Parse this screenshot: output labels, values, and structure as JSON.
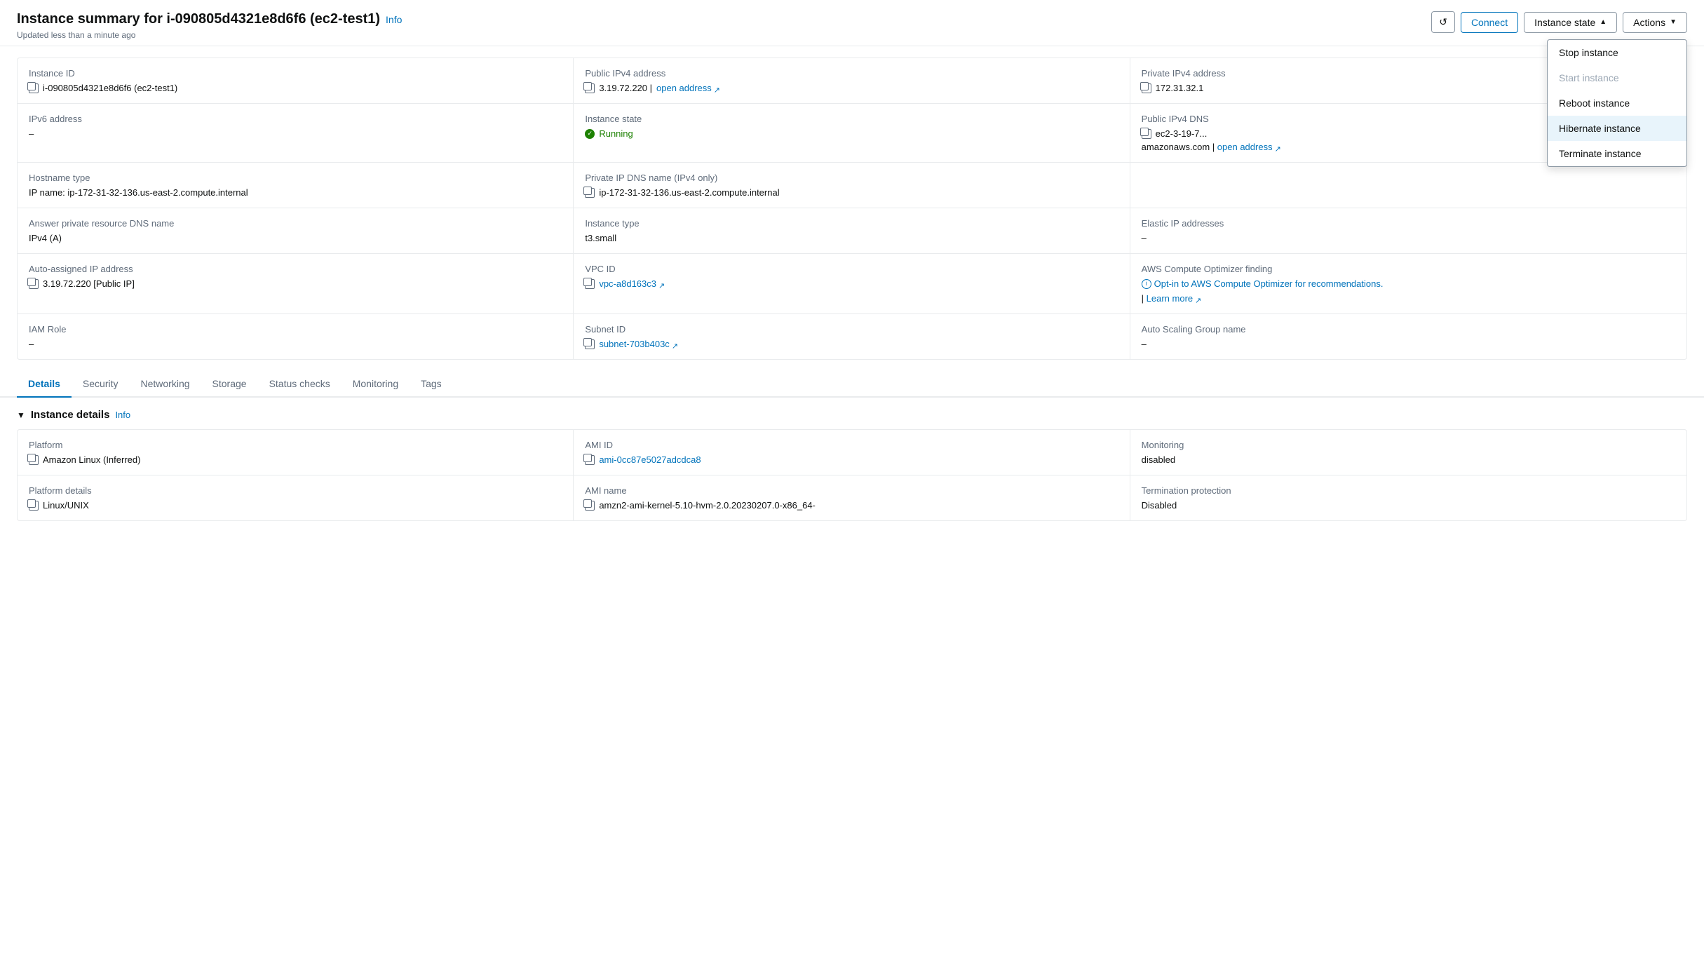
{
  "header": {
    "title": "Instance summary for i-090805d4321e8d6f6 (ec2-test1)",
    "info_label": "Info",
    "subtitle": "Updated less than a minute ago",
    "buttons": {
      "refresh_title": "Refresh",
      "connect": "Connect",
      "instance_state": "Instance state",
      "actions": "Actions"
    }
  },
  "dropdown_menu": {
    "items": [
      {
        "label": "Stop instance",
        "disabled": false,
        "highlighted": false
      },
      {
        "label": "Start instance",
        "disabled": true,
        "highlighted": false
      },
      {
        "label": "Reboot instance",
        "disabled": false,
        "highlighted": false
      },
      {
        "label": "Hibernate instance",
        "disabled": false,
        "highlighted": true
      },
      {
        "label": "Terminate instance",
        "disabled": false,
        "highlighted": false
      }
    ]
  },
  "instance_fields": {
    "row1": [
      {
        "label": "Instance ID",
        "value": "i-090805d4321e8d6f6 (ec2-test1)",
        "has_copy": true,
        "is_link": false
      },
      {
        "label": "Public IPv4 address",
        "value": "3.19.72.220",
        "has_copy": true,
        "has_open_link": true,
        "open_link_text": "open address",
        "is_link": false
      },
      {
        "label": "Private IPv4 address",
        "value": "172.31.32.1",
        "has_copy": true,
        "is_link": false,
        "truncated": true
      }
    ],
    "row2": [
      {
        "label": "IPv6 address",
        "value": "–",
        "has_copy": false
      },
      {
        "label": "Instance state",
        "value": "Running",
        "is_status": true
      },
      {
        "label": "Public IPv4 DNS",
        "value": "ec2-3-19-7...",
        "extra": "amazonaws.com |",
        "has_copy": true,
        "has_open_link": true,
        "open_link_text": "open address",
        "truncated": true
      }
    ],
    "row3": [
      {
        "label": "Hostname type",
        "value": "IP name: ip-172-31-32-136.us-east-2.compute.internal",
        "has_copy": false
      },
      {
        "label": "Private IP DNS name (IPv4 only)",
        "value": "ip-172-31-32-136.us-east-2.compute.internal",
        "has_copy": true
      },
      {
        "label": "",
        "value": "",
        "empty": true
      }
    ],
    "row4": [
      {
        "label": "Answer private resource DNS name",
        "value": "IPv4 (A)",
        "has_copy": false
      },
      {
        "label": "Instance type",
        "value": "t3.small",
        "has_copy": false
      },
      {
        "label": "Elastic IP addresses",
        "value": "–",
        "has_copy": false
      }
    ],
    "row5": [
      {
        "label": "Auto-assigned IP address",
        "value": "3.19.72.220 [Public IP]",
        "has_copy": true
      },
      {
        "label": "VPC ID",
        "value": "vpc-a8d163c3",
        "has_copy": true,
        "is_link": true,
        "has_external": true
      },
      {
        "label": "AWS Compute Optimizer finding",
        "value": "Opt-in to AWS Compute Optimizer for recommendations.",
        "is_optimizer": true,
        "learn_more": "Learn more"
      }
    ],
    "row6": [
      {
        "label": "IAM Role",
        "value": "–",
        "has_copy": false
      },
      {
        "label": "Subnet ID",
        "value": "subnet-703b403c",
        "has_copy": true,
        "is_link": true,
        "has_external": true
      },
      {
        "label": "Auto Scaling Group name",
        "value": "–",
        "has_copy": false
      }
    ]
  },
  "tabs": [
    {
      "label": "Details",
      "active": true
    },
    {
      "label": "Security",
      "active": false
    },
    {
      "label": "Networking",
      "active": false
    },
    {
      "label": "Storage",
      "active": false
    },
    {
      "label": "Status checks",
      "active": false
    },
    {
      "label": "Monitoring",
      "active": false
    },
    {
      "label": "Tags",
      "active": false
    }
  ],
  "instance_details_section": {
    "title": "Instance details",
    "info_label": "Info",
    "fields": {
      "row1": [
        {
          "label": "Platform",
          "value": "Amazon Linux (Inferred)",
          "has_copy": true
        },
        {
          "label": "AMI ID",
          "value": "ami-0cc87e5027adcdca8",
          "has_copy": true,
          "is_link": true
        },
        {
          "label": "Monitoring",
          "value": "disabled"
        }
      ],
      "row2": [
        {
          "label": "Platform details",
          "value": "Linux/UNIX",
          "has_copy": true
        },
        {
          "label": "AMI name",
          "value": "amzn2-ami-kernel-5.10-hvm-2.0.20230207.0-x86_64-",
          "has_copy": true
        },
        {
          "label": "Termination protection",
          "value": "Disabled"
        }
      ]
    }
  }
}
